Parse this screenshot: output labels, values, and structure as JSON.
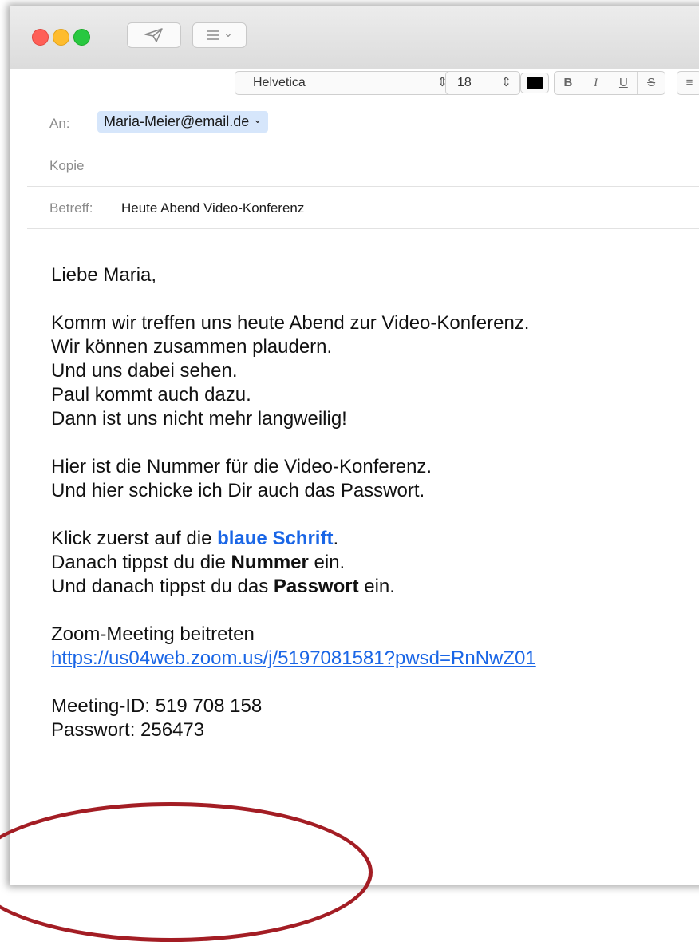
{
  "toolbar": {
    "send_icon": "paper-plane-icon",
    "header_fields_icon": "list-menu-icon",
    "header_fields_chevron": "⌄",
    "font_family": "Helvetica",
    "font_size": "18",
    "text_color": "#000000",
    "style_buttons": [
      "B",
      "I",
      "U",
      "S"
    ],
    "align_icon": "≡"
  },
  "header": {
    "to_label": "An:",
    "to_value": "Maria-Meier@email.de",
    "to_chevron": "⌄",
    "cc_label": "Kopie",
    "subject_label": "Betreff:",
    "subject_value": "Heute Abend Video-Konferenz"
  },
  "body": {
    "greeting": "Liebe Maria,",
    "para1": [
      "Komm wir treffen uns heute Abend zur Video-Konferenz.",
      "Wir können zusammen plaudern.",
      "Und uns dabei sehen.",
      "Paul kommt auch dazu.",
      "Dann ist uns nicht mehr langweilig!"
    ],
    "para2": [
      "Hier ist die Nummer für die Video-Konferenz.",
      "Und hier schicke ich Dir auch das Passwort."
    ],
    "click_line_prefix": "Klick zuerst auf die ",
    "click_line_highlight": "blaue Schrift",
    "click_line_suffix": ".",
    "number_line_prefix": "Danach tippst du die ",
    "number_line_bold": "Nummer",
    "number_line_suffix": " ein.",
    "password_line_prefix": "Und danach tippst du das ",
    "password_line_bold": "Passwort",
    "password_line_suffix": " ein.",
    "zoom_title": "Zoom-Meeting beitreten",
    "zoom_link": "https://us04web.zoom.us/j/5197081581?pwsd=RnNwZ01",
    "meeting_id": "Meeting-ID: 519 708 158",
    "password": "Passwort: 256473"
  },
  "annotation": {
    "circle_color": "#a31d24"
  },
  "colors": {
    "close": "#fe5f57",
    "minimize": "#febc2e",
    "zoom": "#28c840",
    "link": "#1a66e6",
    "token_bg": "#d6e6fb"
  }
}
